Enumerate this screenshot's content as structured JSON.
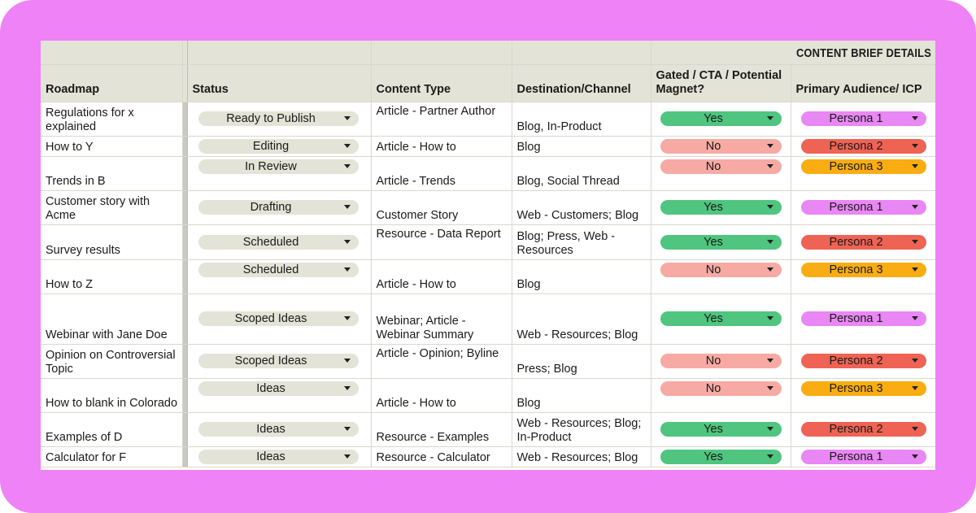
{
  "section_title": "CONTENT BRIEF DETAILS",
  "columns": {
    "roadmap": "Roadmap",
    "status": "Status",
    "content_type": "Content Type",
    "destination": "Destination/Channel",
    "gated": "Gated / CTA / Potential Magnet?",
    "audience": "Primary Audience/ ICP"
  },
  "colors": {
    "frame": "#ee82f6",
    "header_bg": "#e3e3d7",
    "yes": "#4fc57f",
    "no": "#f6aaa3",
    "persona_1": "#e987f4",
    "persona_2": "#ef6354",
    "persona_3": "#f9ad12"
  },
  "rows": [
    {
      "roadmap": "Regulations for x explained",
      "status": "Ready to Publish",
      "content_type": "Article - Partner Author",
      "destination": "Blog, In-Product",
      "gated": "Yes",
      "audience": "Persona 1"
    },
    {
      "roadmap": "How to Y",
      "status": "Editing",
      "content_type": "Article - How to",
      "destination": "Blog",
      "gated": "No",
      "audience": "Persona 2"
    },
    {
      "roadmap": "Trends in B",
      "status": "In Review",
      "content_type": "Article - Trends",
      "destination": "Blog, Social Thread",
      "gated": "No",
      "audience": "Persona 3"
    },
    {
      "roadmap": "Customer story with Acme",
      "status": "Drafting",
      "content_type": "Customer Story",
      "destination": "Web - Customers; Blog",
      "gated": "Yes",
      "audience": "Persona 1"
    },
    {
      "roadmap": "Survey results",
      "status": "Scheduled",
      "content_type": "Resource - Data Report",
      "destination": "Blog; Press, Web - Resources",
      "gated": "Yes",
      "audience": "Persona 2"
    },
    {
      "roadmap": "How to Z",
      "status": "Scheduled",
      "content_type": "Article - How to",
      "destination": "Blog",
      "gated": "No",
      "audience": "Persona 3"
    },
    {
      "roadmap": "Webinar with Jane Doe",
      "status": "Scoped Ideas",
      "content_type": "Webinar; Article - Webinar Summary",
      "destination": "Web - Resources; Blog",
      "gated": "Yes",
      "audience": "Persona 1"
    },
    {
      "roadmap": "Opinion on Controversial Topic",
      "status": "Scoped Ideas",
      "content_type": "Article - Opinion; Byline",
      "destination": "Press; Blog",
      "gated": "No",
      "audience": "Persona 2"
    },
    {
      "roadmap": "How to blank in Colorado",
      "status": "Ideas",
      "content_type": "Article - How to",
      "destination": "Blog",
      "gated": "No",
      "audience": "Persona 3"
    },
    {
      "roadmap": "Examples of D",
      "status": "Ideas",
      "content_type": "Resource - Examples",
      "destination": "Web - Resources; Blog; In-Product",
      "gated": "Yes",
      "audience": "Persona 2"
    },
    {
      "roadmap": "Calculator for F",
      "status": "Ideas",
      "content_type": "Resource - Calculator",
      "destination": "Web - Resources; Blog",
      "gated": "Yes",
      "audience": "Persona 1"
    }
  ]
}
